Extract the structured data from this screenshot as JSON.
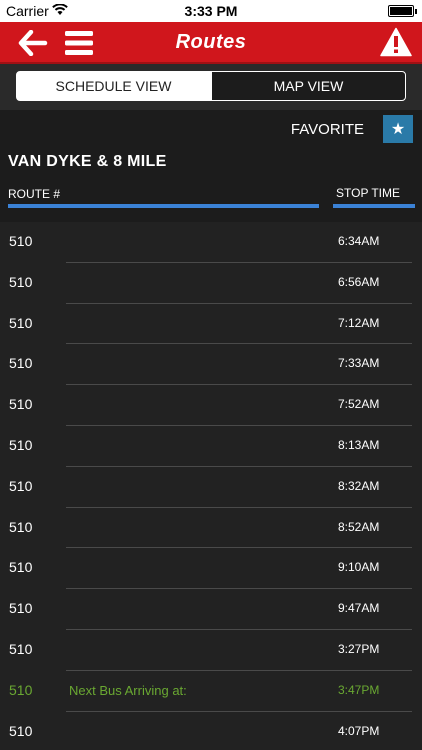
{
  "status_bar": {
    "carrier": "Carrier",
    "time": "3:33 PM"
  },
  "nav": {
    "title": "Routes",
    "back_icon": "back-arrow-icon",
    "menu_icon": "hamburger-menu-icon",
    "alert_icon": "alert-triangle-icon",
    "bar_color": "#d0161c"
  },
  "segments": {
    "schedule_label": "SCHEDULE VIEW",
    "map_label": "MAP VIEW",
    "selected": "SCHEDULE VIEW"
  },
  "favorite": {
    "label": "FAVORITE",
    "icon": "star-icon"
  },
  "stop_name": "VAN DYKE & 8 MILE",
  "columns": {
    "route": "ROUTE #",
    "stop_time": "STOP TIME",
    "accent": "#3b82d6"
  },
  "rows": [
    {
      "route": "510",
      "note": "",
      "time": "6:34AM"
    },
    {
      "route": "510",
      "note": "",
      "time": "6:56AM"
    },
    {
      "route": "510",
      "note": "",
      "time": "7:12AM"
    },
    {
      "route": "510",
      "note": "",
      "time": "7:33AM"
    },
    {
      "route": "510",
      "note": "",
      "time": "7:52AM"
    },
    {
      "route": "510",
      "note": "",
      "time": "8:13AM"
    },
    {
      "route": "510",
      "note": "",
      "time": "8:32AM"
    },
    {
      "route": "510",
      "note": "",
      "time": "8:52AM"
    },
    {
      "route": "510",
      "note": "",
      "time": "9:10AM"
    },
    {
      "route": "510",
      "note": "",
      "time": "9:47AM"
    },
    {
      "route": "510",
      "note": "",
      "time": "3:27PM"
    },
    {
      "route": "510",
      "note": "Next Bus Arriving at:",
      "time": "3:47PM",
      "highlight": true
    },
    {
      "route": "510",
      "note": "",
      "time": "4:07PM"
    }
  ],
  "next_bus_color": "#6aa832"
}
